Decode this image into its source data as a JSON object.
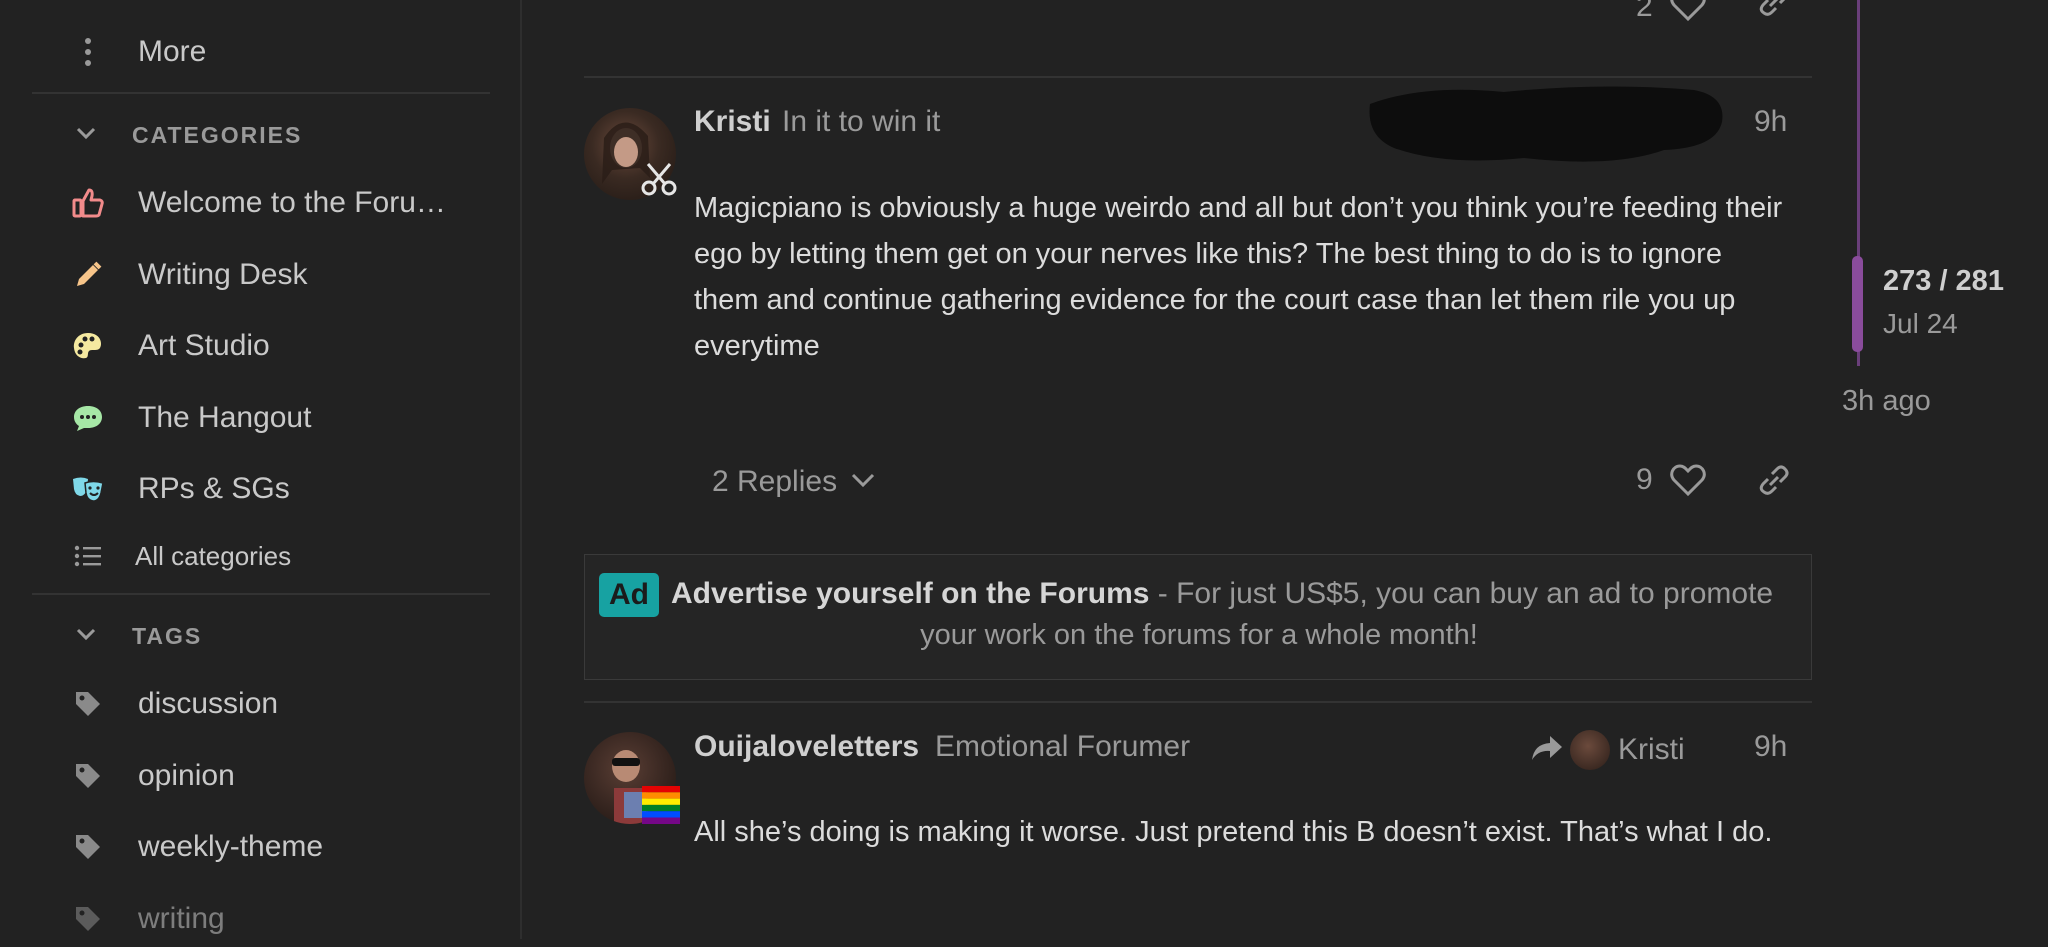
{
  "sidebar": {
    "more_label": "More",
    "categories_header": "CATEGORIES",
    "categories": [
      {
        "label": "Welcome to the Foru…",
        "icon": "thumbs-up-icon",
        "color": "#f28b8b"
      },
      {
        "label": "Writing Desk",
        "icon": "pencil-icon",
        "color": "#f7c58a"
      },
      {
        "label": "Art Studio",
        "icon": "palette-icon",
        "color": "#f5e9a0"
      },
      {
        "label": "The Hangout",
        "icon": "chat-bubble-icon",
        "color": "#a6e7a6"
      },
      {
        "label": "RPs & SGs",
        "icon": "theater-masks-icon",
        "color": "#7fd8e8"
      }
    ],
    "all_categories_label": "All categories",
    "tags_header": "TAGS",
    "tags": [
      {
        "label": "discussion"
      },
      {
        "label": "opinion"
      },
      {
        "label": "weekly-theme"
      },
      {
        "label": "writing"
      }
    ]
  },
  "top_partial": {
    "like_count": "2"
  },
  "posts": [
    {
      "username": "Kristi",
      "user_title": "In it to win it",
      "time": "9h",
      "body": "Magicpiano is obviously a huge weirdo and all but don’t you think you’re feeding their ego by letting them get on your nerves like this? The best thing to do is to ignore them and continue gathering evidence for the court case than let them rile you up everytime",
      "replies_label": "2 Replies",
      "like_count": "9"
    },
    {
      "username": "Ouijaloveletters",
      "user_title": "Emotional Forumer",
      "reply_to": "Kristi",
      "time": "9h",
      "body": "All she’s doing is making it worse. Just pretend this B doesn’t exist. That’s what I do."
    }
  ],
  "ad": {
    "badge": "Ad",
    "title": "Advertise yourself on the Forums",
    "line1_rest": " - For just US$5, you can buy an ad to promote",
    "line2": "your work on the forums for a whole month!"
  },
  "timeline": {
    "position": "273 / 281",
    "date": "Jul 24",
    "ago": "3h ago"
  },
  "colors": {
    "background": "#222222",
    "timeline_accent": "#8a4c9c",
    "ad_badge": "#17a2a2"
  }
}
